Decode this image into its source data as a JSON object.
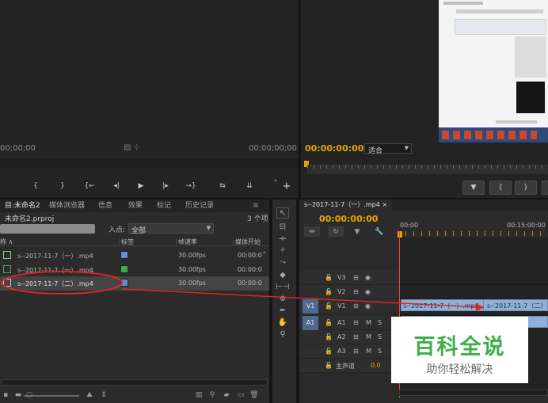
{
  "source_monitor": {
    "timecode_left": "00;00;00",
    "timecode_right": "00;00;00;00",
    "transport": [
      "{",
      "}",
      "{←",
      "◂|",
      "▶",
      "|▸",
      "→}",
      "⇆",
      "⇊"
    ]
  },
  "program_monitor": {
    "timecode": "00:00:00:00",
    "fit_label": "适合",
    "buttons": [
      "▼",
      "{",
      "}"
    ]
  },
  "project_panel": {
    "tabs": [
      "目:未命名2",
      "媒体浏览器",
      "信息",
      "效果",
      "标记",
      "历史记录"
    ],
    "project_file": "未命名2.prproj",
    "item_count": "3 个项",
    "inpoint_label": "入点:",
    "inpoint_value": "全部",
    "columns": [
      "称 ∧",
      "标签",
      "帧速率",
      "媒体开始"
    ],
    "items": [
      {
        "name": "s--2017-11-7（一）.mp4",
        "fps": "30.00fps",
        "start": "00:00:0",
        "color": "#5b8fd6"
      },
      {
        "name": "s--2017-11-7（一）.mp4",
        "fps": "30.00fps",
        "start": "00:00:0",
        "color": "#3fae4a"
      },
      {
        "name": "s--2017-11-7（二）.mp4",
        "fps": "30.00fps",
        "start": "00:00:0",
        "color": "#5b8fd6"
      }
    ]
  },
  "timeline": {
    "tab": "s--2017-11-7（一）.mp4 ×",
    "timecode": "00:00:00:00",
    "ruler_start": "00:00",
    "ruler_mid": "00:15:00:00",
    "video_tracks": [
      {
        "src": "",
        "name": "V3"
      },
      {
        "src": "",
        "name": "V2"
      },
      {
        "src": "V1",
        "name": "V1"
      }
    ],
    "audio_tracks": [
      {
        "src": "A1",
        "name": "A1"
      },
      {
        "src": "",
        "name": "A2"
      },
      {
        "src": "",
        "name": "A3"
      }
    ],
    "master_label": "主声道",
    "master_value": "0.0",
    "clip1": "s--2017-11-7（一）.mp4",
    "clip2": "s--2017-11-7（二）.",
    "mute": "M",
    "solo": "S"
  },
  "watermark": {
    "title": "百科全说",
    "subtitle": "助你轻松解决"
  },
  "colors": {
    "timecode": "#e8a400",
    "playhead": "#e34a3a",
    "clip": "#8fb1d9",
    "annotation": "#d9262a",
    "watermark_title": "#3fae4a"
  }
}
